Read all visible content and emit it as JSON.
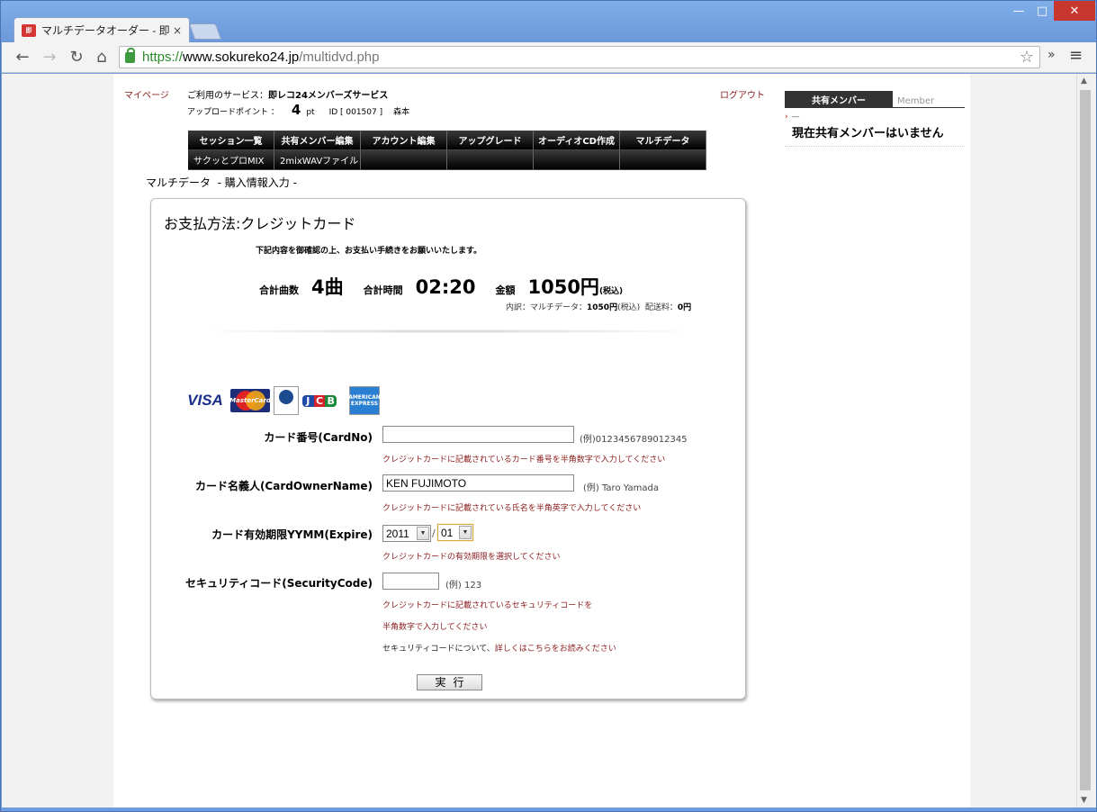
{
  "browser": {
    "tab_title": "マルチデータオーダー - 即レコ",
    "tab_close": "×",
    "url_scheme": "https://",
    "url_host": "www.sokureko24.jp",
    "url_path": "/multidvd.php",
    "win_min": "—",
    "win_max": "□",
    "win_close": "✕",
    "back_glyph": "←",
    "forward_glyph": "→",
    "reload_glyph": "↻",
    "home_glyph": "⌂",
    "star_glyph": "☆",
    "chevron_glyph": "»",
    "menu_glyph": "≡"
  },
  "header": {
    "mypage": "マイページ",
    "service_label": "ご利用のサービス：",
    "service_name": "即レコ24メンバーズサービス",
    "logout": "ログアウト",
    "upload_label": "アップロードポイント ：",
    "upload_points": "4",
    "upload_unit": "pt",
    "user_id": "ID [ 001507 ]",
    "user_name": "森本"
  },
  "menu": {
    "row1": [
      "セッション一覧",
      "共有メンバー編集",
      "アカウント編集",
      "アップグレード",
      "オーディオCD作成",
      "マルチデータ"
    ],
    "row2": [
      "サクッとプロMIX",
      "2mixWAVファイル",
      "",
      "",
      "",
      ""
    ]
  },
  "breadcrumb": {
    "section": "マルチデータ",
    "page": "- 購入情報入力 -"
  },
  "payment": {
    "title": "お支払方法:クレジットカード",
    "note": "下記内容を御確認の上、お支払い手続きをお願いいたします。",
    "count_label": "合計曲数",
    "count_value": "4曲",
    "time_label": "合計時間",
    "time_value": "02:20",
    "amount_label": "金額",
    "amount_value": "1050円",
    "amount_tax": "(税込)",
    "breakdown_prefix": "内訳：マルチデータ：",
    "breakdown_price": "1050円",
    "breakdown_tax": "(税込)",
    "breakdown_ship_label": "配送料：",
    "breakdown_ship": "0円"
  },
  "cards": {
    "visa": "VISA",
    "mastercard": "MasterCard",
    "jcb": [
      "J",
      "C",
      "B"
    ],
    "amex": "AMERICAN EXPRESS"
  },
  "form": {
    "card_no_label": "カード番号(CardNo)",
    "card_no_value": "",
    "card_no_example": "(例)0123456789012345",
    "card_no_help": "クレジットカードに記載されているカード番号を半角数字で入力してください",
    "owner_label": "カード名義人(CardOwnerName)",
    "owner_value": "KEN FUJIMOTO",
    "owner_example": "(例) Taro Yamada",
    "owner_help": "クレジットカードに記載されている氏名を半角英字で入力してください",
    "expire_label": "カード有効期限YYMM(Expire)",
    "expire_year": "2011",
    "expire_sep": "/",
    "expire_month": "01",
    "expire_help": "クレジットカードの有効期限を選択してください",
    "security_label": "セキュリティコード(SecurityCode)",
    "security_value": "",
    "security_example": "(例) 123",
    "security_help1": "クレジットカードに記載されているセキュリティコードを",
    "security_help2": "半角数字で入力してください",
    "security_info_prefix": "セキュリティコードについて、",
    "security_info_link": "詳しくはこちらをお読みください",
    "submit": "実行"
  },
  "share": {
    "tab": "共有メンバー",
    "tab_en": "Member",
    "bullet": "›",
    "dash": "—",
    "message": "現在共有メンバーはいません"
  },
  "colors": {
    "accent_link": "#8b1c1c",
    "menu_bg": "#000000",
    "url_green": "#2c8a2c"
  }
}
